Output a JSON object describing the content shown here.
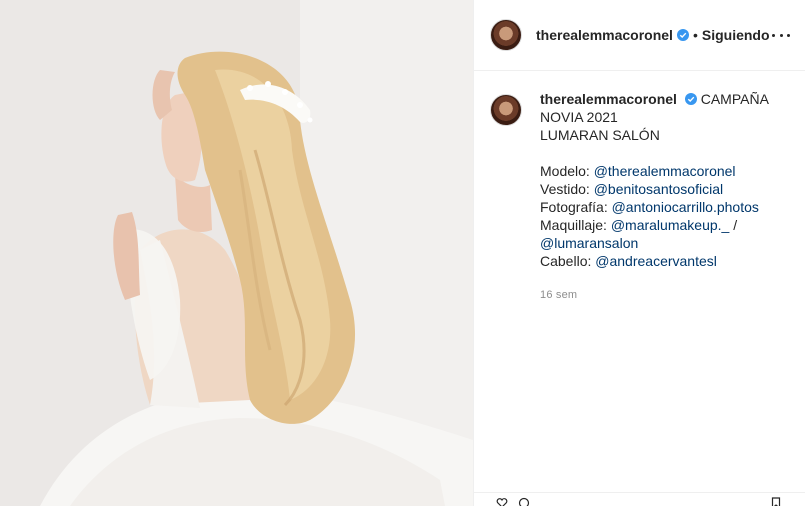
{
  "header": {
    "username": "therealemmacoronel",
    "separator": "•",
    "follow_state": "Siguiendo"
  },
  "caption": {
    "username": "therealemmacoronel",
    "line1": "CAMPAÑA NOVIA 2021",
    "line2": "LUMARAN SALÓN",
    "credits": [
      {
        "label": "Modelo: ",
        "mention": "@therealemmacoronel",
        "suffix": ""
      },
      {
        "label": "Vestido: ",
        "mention": "@benitosantosoficial",
        "suffix": ""
      },
      {
        "label": "Fotografía: ",
        "mention": "@antoniocarrillo.photos",
        "suffix": ""
      },
      {
        "label": "Maquillaje: ",
        "mention": "@maralumakeup._",
        "suffix": " /"
      },
      {
        "label": "",
        "mention": "@lumaransalon",
        "suffix": ""
      },
      {
        "label": "Cabello: ",
        "mention": "@andreacervantesl",
        "suffix": ""
      }
    ],
    "time": "16 sem"
  },
  "icons": {
    "verified": "verified-badge-icon",
    "more": "more-options-icon"
  },
  "colors": {
    "mention": "#00376b",
    "verified": "#3897f0",
    "muted": "#8e8e8e"
  }
}
